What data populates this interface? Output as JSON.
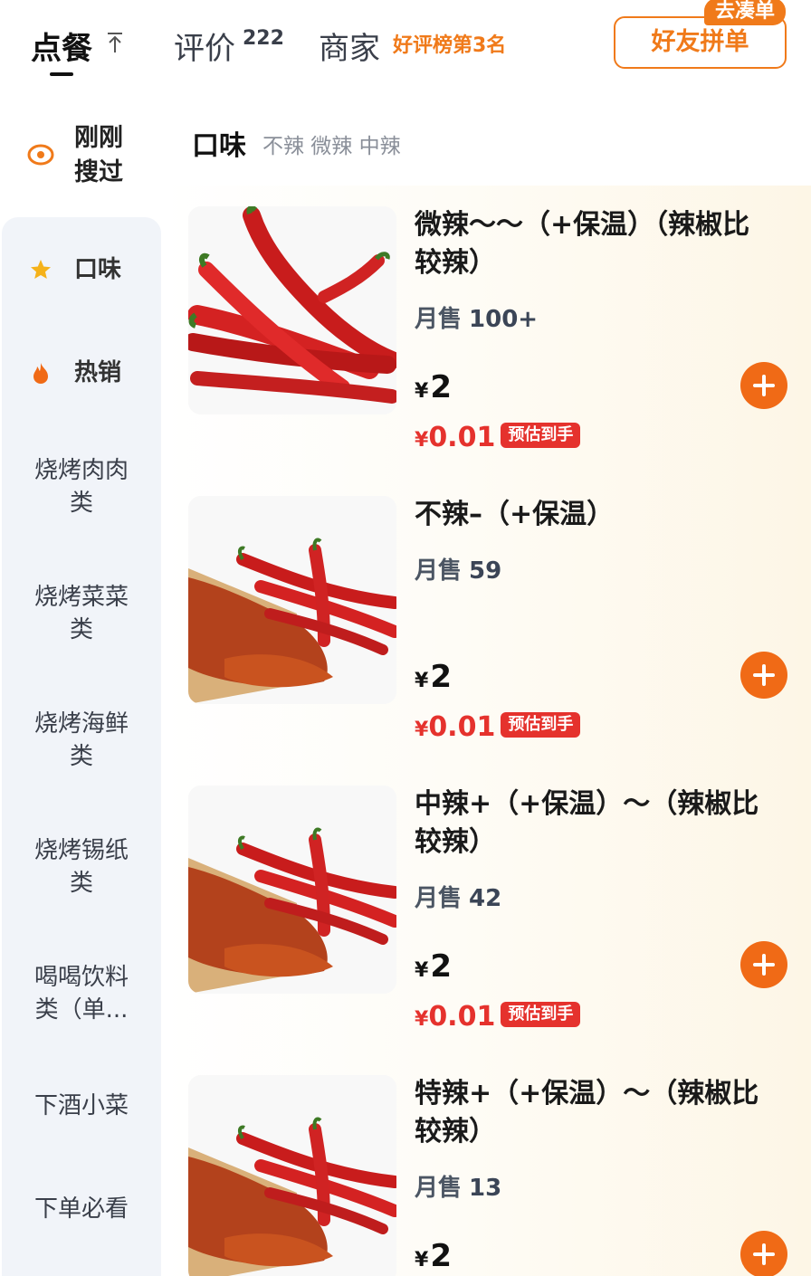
{
  "tabs": {
    "order": "点餐",
    "reviews": "评价",
    "reviews_count": "222",
    "merchant": "商家",
    "merchant_rank": "好评榜第3名",
    "group_order": "好友拼单",
    "group_badge": "去凑单"
  },
  "recent": {
    "label": "刚刚搜过"
  },
  "sidebar": {
    "items": [
      {
        "label": "口味",
        "icon": "star-icon"
      },
      {
        "label": "热销",
        "icon": "flame-icon"
      },
      {
        "label": "烧烤肉肉类"
      },
      {
        "label": "烧烤菜菜类"
      },
      {
        "label": "烧烤海鲜类"
      },
      {
        "label": "烧烤锡纸类"
      },
      {
        "label": "喝喝饮料类（单..."
      },
      {
        "label": "下酒小菜"
      },
      {
        "label": "下单必看"
      }
    ]
  },
  "section": {
    "title": "口味",
    "tags": "不辣 微辣 中辣"
  },
  "items": [
    {
      "name": "微辣～～（+保温）（辣椒比较辣）",
      "monthly_label": "月售",
      "monthly": "100+",
      "currency": "¥",
      "price": "2",
      "promo_price": "0.01",
      "promo_badge": "预估到手",
      "image": "fresh-chili-peppers"
    },
    {
      "name": "不辣–（+保温）",
      "monthly_label": "月售",
      "monthly": "59",
      "currency": "¥",
      "price": "2",
      "promo_price": "0.01",
      "promo_badge": "预估到手",
      "image": "chili-powder"
    },
    {
      "name": "中辣+（+保温）～（辣椒比较辣）",
      "monthly_label": "月售",
      "monthly": "42",
      "currency": "¥",
      "price": "2",
      "promo_price": "0.01",
      "promo_badge": "预估到手",
      "image": "chili-powder"
    },
    {
      "name": "特辣+（+保温）～（辣椒比较辣）",
      "monthly_label": "月售",
      "monthly": "13",
      "currency": "¥",
      "price": "2",
      "image": "chili-powder"
    }
  ],
  "colors": {
    "accent": "#f07a1a",
    "promo": "#e5322d",
    "add_button": "#f06a16"
  }
}
